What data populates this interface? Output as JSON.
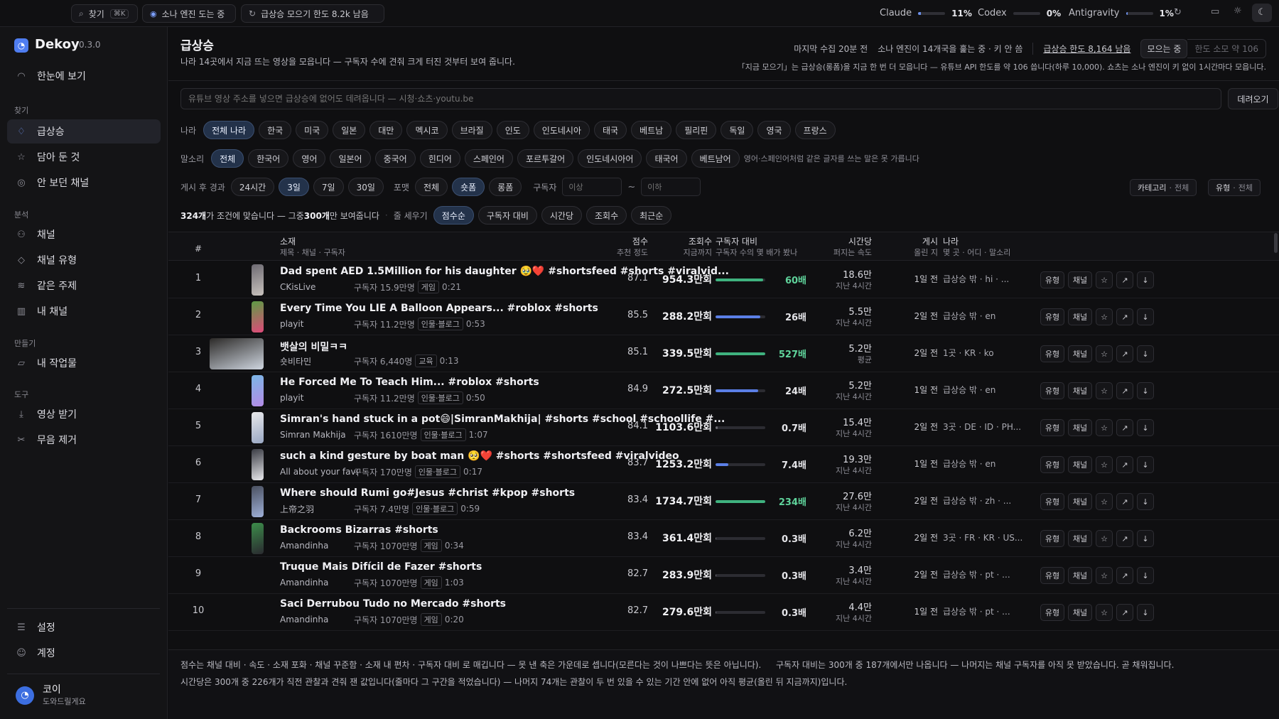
{
  "topbar": {
    "search_label": "찾기",
    "search_kbd": "⌘K",
    "sona_label": "소나 엔진 도는 중",
    "collect_label": "급상승 모으기 한도 8.2k 남음",
    "meters": [
      {
        "name": "Claude",
        "pct": "11%",
        "fill": 0.11
      },
      {
        "name": "Codex",
        "pct": "0%",
        "fill": 0.0
      },
      {
        "name": "Antigravity",
        "pct": "1%",
        "fill": 0.01
      }
    ]
  },
  "sidebar": {
    "app_name": "Dekoy",
    "version": "0.3.0",
    "overview": "한눈에 보기",
    "sec_find": "찾기",
    "find_items": [
      "급상승",
      "담아 둔 것",
      "안 보던 채널"
    ],
    "sec_analysis": "분석",
    "analysis_items": [
      "채널",
      "채널 유형",
      "같은 주제",
      "내 채널"
    ],
    "sec_make": "만들기",
    "make_items": [
      "내 작업물"
    ],
    "sec_tools": "도구",
    "tool_items": [
      "영상 받기",
      "무음 제거"
    ],
    "bottom_items": [
      "설정",
      "계정"
    ],
    "user_name": "코이",
    "user_sub": "도와드릴게요"
  },
  "header": {
    "title": "급상승",
    "subtitle": "나라 14곳에서 지금 뜨는 영상을 모읍니다 — 구독자 수에 견줘 크게 터진 것부터 보여 줍니다.",
    "last_collect": "마지막 수집 20분 전",
    "sona_status": "소나 엔진이 14개국을 훑는 중 · 키 안 씀",
    "quota": "급상승 한도 8,164 남음",
    "collecting": "모으는 중",
    "quota_hint": "한도 소모 약 106",
    "note": "「지금 모으기」는 급상승(롱폼)을 지금 한 번 더 모읍니다 — 유튜브 API 한도를 약 106 씁니다(하루 10,000). 쇼츠는 소나 엔진이 키 없이 1시간마다 모읍니다."
  },
  "url": {
    "placeholder": "유튜브 영상 주소를 넣으면 급상승에 없어도 데려옵니다 — 시청·쇼츠·youtu.be",
    "button": "데려오기"
  },
  "filters": {
    "country_label": "나라",
    "countries": [
      "전체 나라",
      "한국",
      "미국",
      "일본",
      "대만",
      "멕시코",
      "브라질",
      "인도",
      "인도네시아",
      "태국",
      "베트남",
      "필리핀",
      "독일",
      "영국",
      "프랑스"
    ],
    "lang_label": "말소리",
    "langs": [
      "전체",
      "한국어",
      "영어",
      "일본어",
      "중국어",
      "힌디어",
      "스페인어",
      "포르투갈어",
      "인도네시아어",
      "태국어",
      "베트남어"
    ],
    "lang_note": "영어·스페인어처럼 같은 글자를 쓰는 말은 못 가릅니다",
    "period_label": "게시 후 경과",
    "periods": [
      "24시간",
      "3일",
      "7일",
      "30일"
    ],
    "format_label": "포맷",
    "formats": [
      "전체",
      "숏폼",
      "롱폼"
    ],
    "subs_label": "구독자",
    "subs_min": "이상",
    "subs_max": "이하",
    "subs_sep": "~",
    "category_label": "카테고리",
    "category_value": "전체",
    "type_label": "유형",
    "type_value": "전체"
  },
  "summary": {
    "count": "324개",
    "count_tail": "가 조건에 맞습니다 — 그중 ",
    "shown": "300개",
    "shown_tail": "만 보여줍니다",
    "sort_label": "줄 세우기",
    "sorts": [
      "점수순",
      "구독자 대비",
      "시간당",
      "조회수",
      "최근순"
    ]
  },
  "columns": {
    "num": "#",
    "subject": "소재",
    "subject_sub": "제목 · 채널 · 구독자",
    "score": "점수",
    "score_sub": "추천 정도",
    "views": "조회수",
    "views_sub": "지금까지",
    "ratio": "구독자 대비",
    "ratio_sub": "구독자 수의 몇 배가 봤나",
    "hourly": "시간당",
    "hourly_sub": "퍼지는 속도",
    "posted": "게시",
    "posted_sub": "올린 지",
    "country": "나라",
    "country_sub": "몇 곳 · 어디 · 말소리"
  },
  "row_buttons": {
    "type": "유형",
    "channel": "채널"
  },
  "rows": [
    {
      "n": "1",
      "title": "Dad spent AED 1.5Million for his daughter 🥹❤️ #shortsfeed #shorts #viralvid...",
      "channel": "CKisLive",
      "subs": "구독자 15.9만명",
      "cat": "게임",
      "dur": "0:21",
      "score": "87.1",
      "views": "954.3만회",
      "ratio": "60배",
      "ratio_fill": 0.95,
      "ratio_color": "#3fb27f",
      "hourly": "18.6만",
      "hourly_sub": "지난 4시간",
      "posted": "1일 전",
      "country": "급상승 밖 · hi · ..."
    },
    {
      "n": "2",
      "title": "Every Time You LIE A Balloon Appears... #roblox #shorts",
      "channel": "playit",
      "subs": "구독자 11.2만명",
      "cat": "인물·블로그",
      "dur": "0:53",
      "score": "85.5",
      "views": "288.2만회",
      "ratio": "26배",
      "ratio_fill": 0.9,
      "ratio_color": "#5b7fe6",
      "hourly": "5.5만",
      "hourly_sub": "지난 4시간",
      "posted": "2일 전",
      "country": "급상승 밖 · en"
    },
    {
      "n": "3",
      "title": "뱃살의 비밀ㅋㅋ",
      "channel": "숏비타민",
      "subs": "구독자 6,440명",
      "cat": "교육",
      "dur": "0:13",
      "score": "85.1",
      "views": "339.5만회",
      "ratio": "527배",
      "ratio_fill": 1.0,
      "ratio_color": "#3fb27f",
      "hourly": "5.2만",
      "hourly_sub": "평균",
      "posted": "2일 전",
      "country": "1곳 · KR · ko"
    },
    {
      "n": "4",
      "title": "He Forced Me To Teach Him... #roblox #shorts",
      "channel": "playit",
      "subs": "구독자 11.2만명",
      "cat": "인물·블로그",
      "dur": "0:50",
      "score": "84.9",
      "views": "272.5만회",
      "ratio": "24배",
      "ratio_fill": 0.85,
      "ratio_color": "#5b7fe6",
      "hourly": "5.2만",
      "hourly_sub": "지난 4시간",
      "posted": "1일 전",
      "country": "급상승 밖 · en"
    },
    {
      "n": "5",
      "title": "Simran's hand stuck in a pot😄|SimranMakhija| #shorts #school #schoollife #...",
      "channel": "Simran Makhija",
      "subs": "구독자 1610만명",
      "cat": "인물·블로그",
      "dur": "1:07",
      "score": "84.1",
      "views": "1103.6만회",
      "ratio": "0.7배",
      "ratio_fill": 0.04,
      "ratio_color": "#6b6b73",
      "hourly": "15.4만",
      "hourly_sub": "지난 4시간",
      "posted": "2일 전",
      "country": "3곳 · DE · ID · PH..."
    },
    {
      "n": "6",
      "title": "such a kind gesture by boat man 🥺❤️ #shorts #shortsfeed #viralvideo",
      "channel": "All about your favs",
      "subs": "구독자 170만명",
      "cat": "인물·블로그",
      "dur": "0:17",
      "score": "83.7",
      "views": "1253.2만회",
      "ratio": "7.4배",
      "ratio_fill": 0.25,
      "ratio_color": "#5b7fe6",
      "hourly": "19.3만",
      "hourly_sub": "지난 4시간",
      "posted": "1일 전",
      "country": "급상승 밖 · en"
    },
    {
      "n": "7",
      "title": "Where should Rumi go#Jesus #christ #kpop #shorts",
      "channel": "上帝之羽",
      "subs": "구독자 7.4만명",
      "cat": "인물·블로그",
      "dur": "0:59",
      "score": "83.4",
      "views": "1734.7만회",
      "ratio": "234배",
      "ratio_fill": 1.0,
      "ratio_color": "#3fb27f",
      "hourly": "27.6만",
      "hourly_sub": "지난 4시간",
      "posted": "2일 전",
      "country": "급상승 밖 · zh · ..."
    },
    {
      "n": "8",
      "title": "Backrooms Bizarras #shorts",
      "channel": "Amandinha",
      "subs": "구독자 1070만명",
      "cat": "게임",
      "dur": "0:34",
      "score": "83.4",
      "views": "361.4만회",
      "ratio": "0.3배",
      "ratio_fill": 0.02,
      "ratio_color": "#6b6b73",
      "hourly": "6.2만",
      "hourly_sub": "지난 4시간",
      "posted": "2일 전",
      "country": "3곳 · FR · KR · US..."
    },
    {
      "n": "9",
      "title": "Truque Mais Difícil de Fazer #shorts",
      "channel": "Amandinha",
      "subs": "구독자 1070만명",
      "cat": "게임",
      "dur": "1:03",
      "score": "82.7",
      "views": "283.9만회",
      "ratio": "0.3배",
      "ratio_fill": 0.02,
      "ratio_color": "#6b6b73",
      "hourly": "3.4만",
      "hourly_sub": "지난 4시간",
      "posted": "2일 전",
      "country": "급상승 밖 · pt · ..."
    },
    {
      "n": "10",
      "title": "Saci Derrubou Tudo no Mercado #shorts",
      "channel": "Amandinha",
      "subs": "구독자 1070만명",
      "cat": "게임",
      "dur": "0:20",
      "score": "82.7",
      "views": "279.6만회",
      "ratio": "0.3배",
      "ratio_fill": 0.02,
      "ratio_color": "#6b6b73",
      "hourly": "4.4만",
      "hourly_sub": "지난 4시간",
      "posted": "1일 전",
      "country": "급상승 밖 · pt · ..."
    }
  ],
  "footer": {
    "line1a": "점수는 채널 대비 · 속도 · 소재 포화 · 채널 꾸준함 · 소재 내 편차 · 구독자 대비 로 매깁니다 — 못 낸 축은 가운데로 셉니다(모른다는 것이 나쁘다는 뜻은 아닙니다).",
    "line1b": "구독자 대비는 300개 중 187개에서만 나옵니다 — 나머지는 채널 구독자를 아직 못 받았습니다. 곧 채워집니다.",
    "line2": "시간당은 300개 중 226개가 직전 관찰과 견줘 잰 값입니다(줄마다 그 구간을 적었습니다) — 나머지 74개는 관찰이 두 번 있을 수 있는 기간 안에 없어 아직 평균(올린 뒤 지금까지)입니다."
  }
}
